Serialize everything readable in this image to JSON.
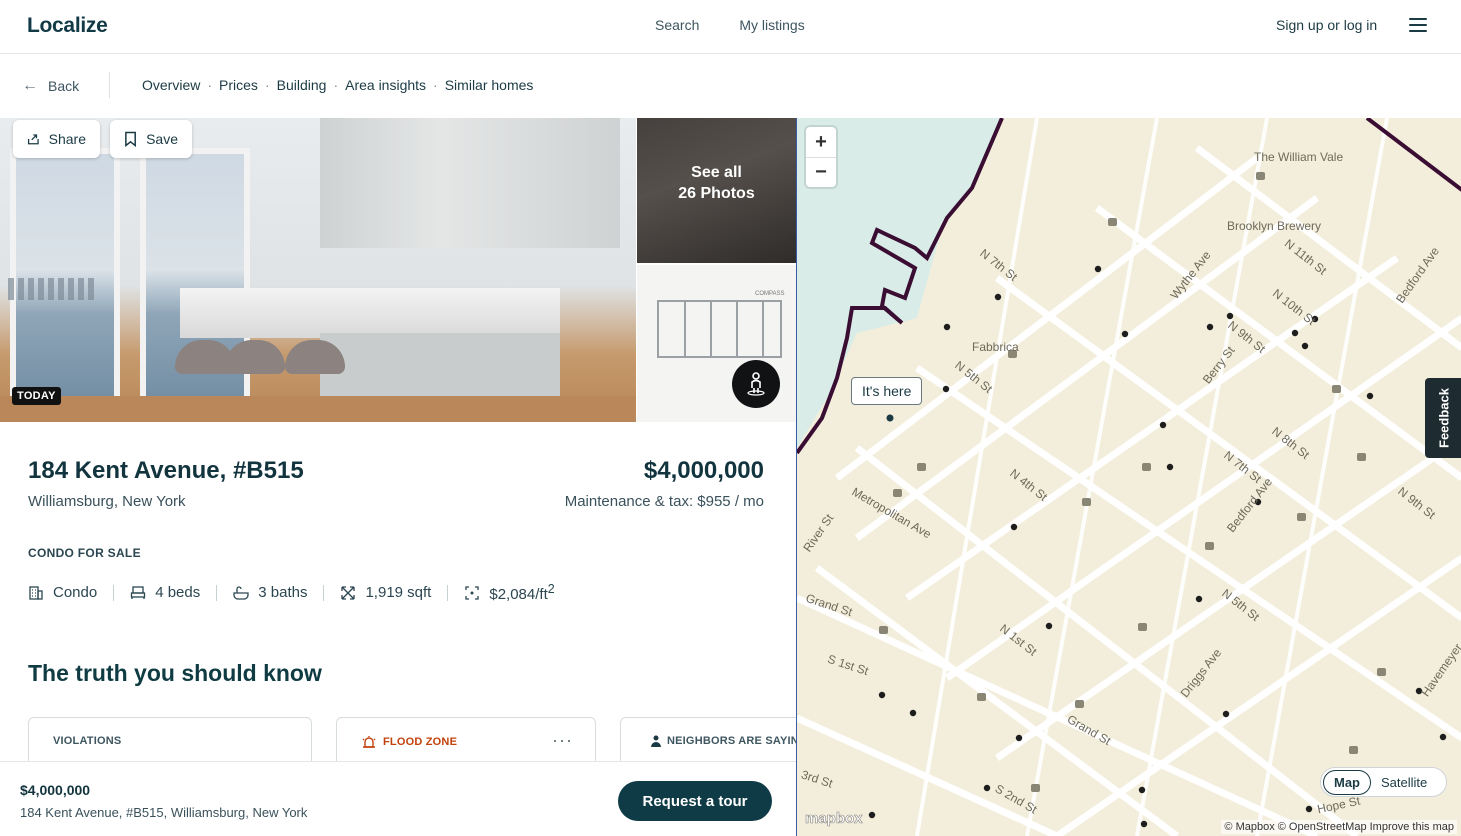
{
  "header": {
    "logo": "Localize",
    "nav": [
      "Search",
      "My listings"
    ],
    "signin": "Sign up or log in"
  },
  "subnav": {
    "back": "Back",
    "links": [
      "Overview",
      "Prices",
      "Building",
      "Area insights",
      "Similar homes"
    ],
    "separator": "·"
  },
  "gallery": {
    "share": "Share",
    "save": "Save",
    "badge": "TODAY",
    "see_all_line1": "See all",
    "see_all_line2": "26 Photos",
    "plan_brand": "COMPASS"
  },
  "listing": {
    "address": "184 Kent Avenue, #B515",
    "city": "Williamsburg, New York",
    "price": "$4,000,000",
    "maintenance": "Maintenance & tax: $955 / mo",
    "type_label": "CONDO FOR SALE",
    "facts": {
      "type": "Condo",
      "beds": "4 beds",
      "baths": "3 baths",
      "sqft": "1,919 sqft",
      "ppsf": "$2,084/ft",
      "ppsf_sup": "2"
    },
    "section_title": "The truth you should know",
    "cards": {
      "violations": "VIOLATIONS",
      "flood": "FLOOD ZONE",
      "neighbors": "NEIGHBORS ARE SAYING",
      "more": "···"
    }
  },
  "bottom_bar": {
    "price": "$4,000,000",
    "address": "184 Kent Avenue, #B515, Williamsburg, New York",
    "cta": "Request a tour"
  },
  "map": {
    "zoom_in": "+",
    "zoom_out": "−",
    "callout": "It's here",
    "feedback": "Feedback",
    "toggle_map": "Map",
    "toggle_satellite": "Satellite",
    "logo": "mapbox",
    "attribution": "© Mapbox © OpenStreetMap Improve this map",
    "places": [
      "The William Vale",
      "Brooklyn Brewery",
      "Fabbrica"
    ],
    "streets": [
      "N 7th St",
      "N 5th St",
      "N 4th St",
      "N 1st St",
      "Wythe Ave",
      "Berry St",
      "Bedford Ave",
      "Driggs Ave",
      "N 9th St",
      "N 10th St",
      "N 11th St",
      "N 8th St",
      "N 7th St",
      "N 5th St",
      "Metropolitan Ave",
      "River St",
      "Grand St",
      "S 1st St",
      "Grand St",
      "3rd St",
      "S 2nd St",
      "Hope St",
      "Bedford Ave",
      "N 9th St",
      "Havemeyer"
    ],
    "colors": {
      "land": "#f3eedb",
      "water": "#d9ece8",
      "road": "#ffffff",
      "boundary": "#3a0d33"
    }
  }
}
